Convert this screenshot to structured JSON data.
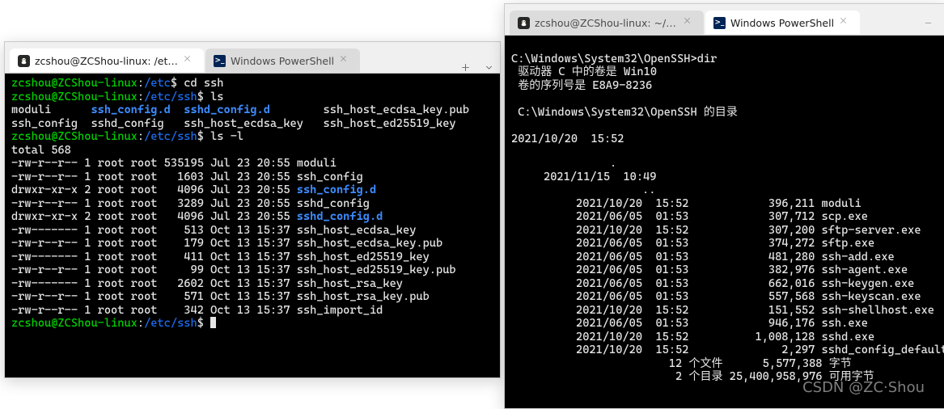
{
  "watermark": "CSDN @ZC·Shou",
  "left_window": {
    "tabs": [
      {
        "label": "zcshou@ZCShou-linux: /etc/ssh",
        "active": true,
        "icon": "tux"
      },
      {
        "label": "Windows PowerShell",
        "active": false,
        "icon": "ps"
      }
    ],
    "prompt": {
      "host": "zcshou@ZCShou-linux",
      "path_etc": "/etc",
      "path_ssh": "/etc/ssh"
    },
    "cmd1": "cd ssh",
    "cmd2": "ls",
    "cmd3": "ls -l",
    "ls_output": {
      "plain": [
        "moduli",
        "ssh_config",
        "sshd_config"
      ],
      "dirs": [
        "ssh_config.d",
        "sshd_config.d"
      ],
      "rest": [
        "ssh_host_ecdsa_key",
        "ssh_host_ecdsa_key.pub",
        "ssh_host_ed25519_key"
      ]
    },
    "total_line": "total 568",
    "files": [
      {
        "perm": "-rw-r--r--",
        "links": "1",
        "owner": "root",
        "group": "root",
        "size": "535195",
        "date": "Jul 23 20:55",
        "name": "moduli",
        "dir": false
      },
      {
        "perm": "-rw-r--r--",
        "links": "1",
        "owner": "root",
        "group": "root",
        "size": "1603",
        "date": "Jul 23 20:55",
        "name": "ssh_config",
        "dir": false
      },
      {
        "perm": "drwxr-xr-x",
        "links": "2",
        "owner": "root",
        "group": "root",
        "size": "4096",
        "date": "Jul 23 20:55",
        "name": "ssh_config.d",
        "dir": true
      },
      {
        "perm": "-rw-r--r--",
        "links": "1",
        "owner": "root",
        "group": "root",
        "size": "3289",
        "date": "Jul 23 20:55",
        "name": "sshd_config",
        "dir": false
      },
      {
        "perm": "drwxr-xr-x",
        "links": "2",
        "owner": "root",
        "group": "root",
        "size": "4096",
        "date": "Jul 23 20:55",
        "name": "sshd_config.d",
        "dir": true
      },
      {
        "perm": "-rw-------",
        "links": "1",
        "owner": "root",
        "group": "root",
        "size": "513",
        "date": "Oct 13 15:37",
        "name": "ssh_host_ecdsa_key",
        "dir": false
      },
      {
        "perm": "-rw-r--r--",
        "links": "1",
        "owner": "root",
        "group": "root",
        "size": "179",
        "date": "Oct 13 15:37",
        "name": "ssh_host_ecdsa_key.pub",
        "dir": false
      },
      {
        "perm": "-rw-------",
        "links": "1",
        "owner": "root",
        "group": "root",
        "size": "411",
        "date": "Oct 13 15:37",
        "name": "ssh_host_ed25519_key",
        "dir": false
      },
      {
        "perm": "-rw-r--r--",
        "links": "1",
        "owner": "root",
        "group": "root",
        "size": "99",
        "date": "Oct 13 15:37",
        "name": "ssh_host_ed25519_key.pub",
        "dir": false
      },
      {
        "perm": "-rw-------",
        "links": "1",
        "owner": "root",
        "group": "root",
        "size": "2602",
        "date": "Oct 13 15:37",
        "name": "ssh_host_rsa_key",
        "dir": false
      },
      {
        "perm": "-rw-r--r--",
        "links": "1",
        "owner": "root",
        "group": "root",
        "size": "571",
        "date": "Oct 13 15:37",
        "name": "ssh_host_rsa_key.pub",
        "dir": false
      },
      {
        "perm": "-rw-r--r--",
        "links": "1",
        "owner": "root",
        "group": "root",
        "size": "342",
        "date": "Oct 13 15:37",
        "name": "ssh_import_id",
        "dir": false
      }
    ]
  },
  "right_window": {
    "tabs": [
      {
        "label": "zcshou@ZCShou-linux: ~/Docu",
        "active": false,
        "icon": "tux"
      },
      {
        "label": "Windows PowerShell",
        "active": true,
        "icon": "ps"
      }
    ],
    "prompt_line": "C:\\Windows\\System32\\OpenSSH>dir",
    "vol_line": " 驱动器 C 中的卷是 Win10",
    "serial_line": " 卷的序列号是 E8A9-8236",
    "dir_of_line": " C:\\Windows\\System32\\OpenSSH 的目录",
    "entries": [
      {
        "date": "2021/10/20",
        "time": "15:52",
        "dir": true,
        "size": "",
        "name": "."
      },
      {
        "date": "2021/11/15",
        "time": "10:49",
        "dir": true,
        "size": "",
        "name": ".."
      },
      {
        "date": "2021/10/20",
        "time": "15:52",
        "dir": false,
        "size": "396,211",
        "name": "moduli"
      },
      {
        "date": "2021/06/05",
        "time": "01:53",
        "dir": false,
        "size": "307,712",
        "name": "scp.exe"
      },
      {
        "date": "2021/10/20",
        "time": "15:52",
        "dir": false,
        "size": "307,200",
        "name": "sftp-server.exe"
      },
      {
        "date": "2021/06/05",
        "time": "01:53",
        "dir": false,
        "size": "374,272",
        "name": "sftp.exe"
      },
      {
        "date": "2021/06/05",
        "time": "01:53",
        "dir": false,
        "size": "481,280",
        "name": "ssh-add.exe"
      },
      {
        "date": "2021/06/05",
        "time": "01:53",
        "dir": false,
        "size": "382,976",
        "name": "ssh-agent.exe"
      },
      {
        "date": "2021/06/05",
        "time": "01:53",
        "dir": false,
        "size": "662,016",
        "name": "ssh-keygen.exe"
      },
      {
        "date": "2021/06/05",
        "time": "01:53",
        "dir": false,
        "size": "557,568",
        "name": "ssh-keyscan.exe"
      },
      {
        "date": "2021/10/20",
        "time": "15:52",
        "dir": false,
        "size": "151,552",
        "name": "ssh-shellhost.exe"
      },
      {
        "date": "2021/06/05",
        "time": "01:53",
        "dir": false,
        "size": "946,176",
        "name": "ssh.exe"
      },
      {
        "date": "2021/10/20",
        "time": "15:52",
        "dir": false,
        "size": "1,008,128",
        "name": "sshd.exe"
      },
      {
        "date": "2021/10/20",
        "time": "15:52",
        "dir": false,
        "size": "2,297",
        "name": "sshd_config_default"
      }
    ],
    "summary1": "              12 个文件      5,577,388 字节",
    "summary2": "               2 个目录 25,400,958,976 可用字节"
  }
}
